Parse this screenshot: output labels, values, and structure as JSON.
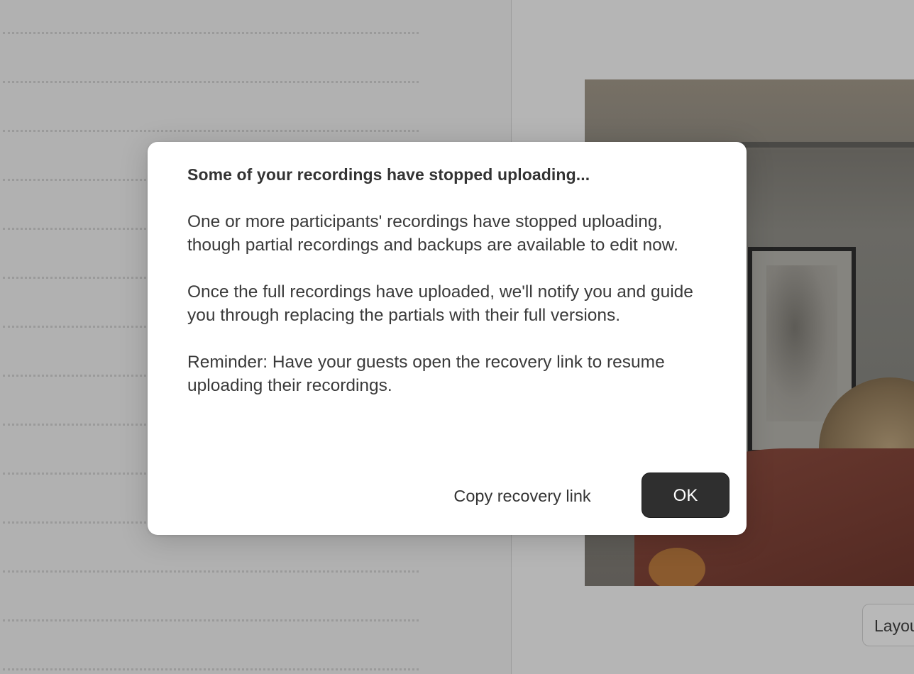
{
  "dialog": {
    "title": "Some of your recordings have stopped uploading...",
    "paragraphs": [
      "One or more participants' recordings have stopped uploading, though partial recordings and backups are available to edit now.",
      "Once the full recordings have uploaded, we'll notify you and guide you through replacing the partials with their full versions.",
      "Reminder: Have your guests open the recovery link to resume uploading their recordings."
    ],
    "secondary_button_label": "Copy recovery link",
    "primary_button_label": "OK"
  },
  "background": {
    "layout_button_label": "Layout"
  },
  "colors": {
    "overlay_gray": "#b3b3b3",
    "dialog_background": "#ffffff",
    "primary_button": "#2f2f2f",
    "text": "#333333"
  }
}
